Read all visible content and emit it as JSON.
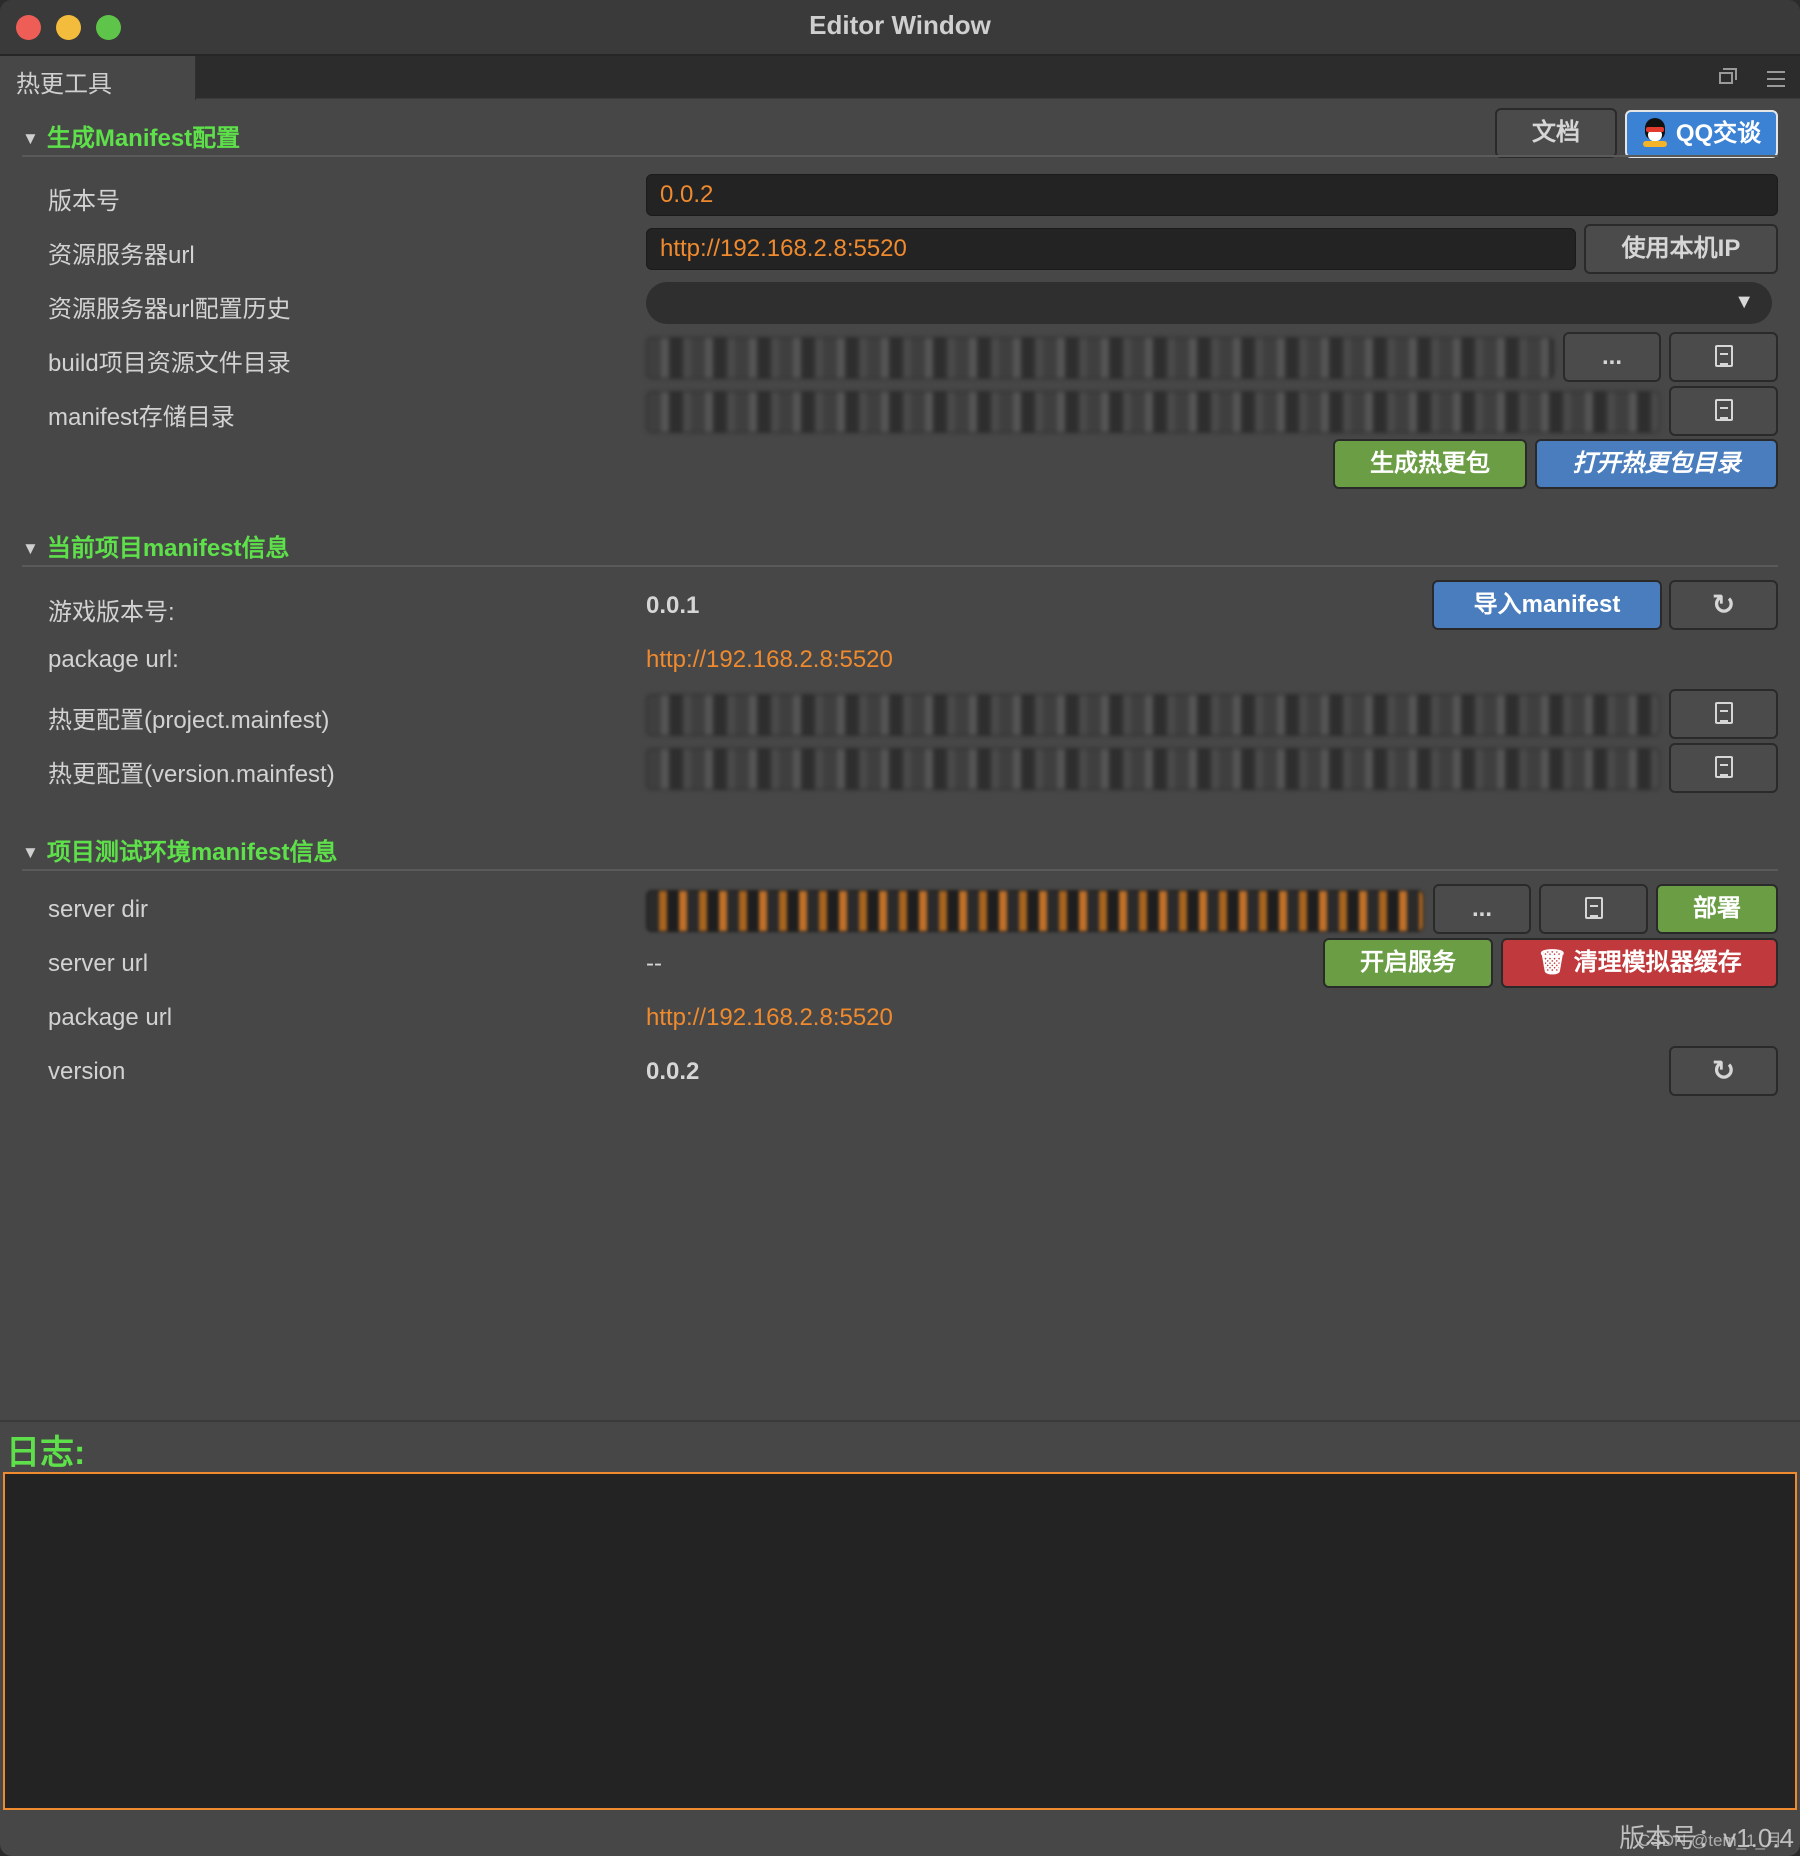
{
  "window": {
    "title": "Editor Window"
  },
  "tab": {
    "label": "热更工具"
  },
  "section_manifest": {
    "title": "生成Manifest配置",
    "doc_button": "文档",
    "qq_button": "QQ交谈",
    "version_label": "版本号",
    "version_value": "0.0.2",
    "server_url_label": "资源服务器url",
    "server_url_value": "http://192.168.2.8:5520",
    "use_local_ip_button": "使用本机IP",
    "url_history_label": "资源服务器url配置历史",
    "url_history_value": "",
    "build_dir_label": "build项目资源文件目录",
    "browse_button": "...",
    "manifest_dir_label": "manifest存储目录",
    "generate_button": "生成热更包",
    "open_dir_button": "打开热更包目录"
  },
  "section_current": {
    "title": "当前项目manifest信息",
    "game_version_label": "游戏版本号:",
    "game_version_value": "0.0.1",
    "import_button": "导入manifest",
    "package_url_label": "package url:",
    "package_url_value": "http://192.168.2.8:5520",
    "project_manifest_label": "热更配置(project.mainfest)",
    "version_manifest_label": "热更配置(version.mainfest)"
  },
  "section_test": {
    "title": "项目测试环境manifest信息",
    "server_dir_label": "server dir",
    "browse_button": "...",
    "deploy_button": "部署",
    "server_url_label": "server url",
    "server_url_value": "--",
    "start_service_button": "开启服务",
    "clear_cache_button": "清理模拟器缓存",
    "package_url_label": "package url",
    "package_url_value": "http://192.168.2.8:5520",
    "version_label": "version",
    "version_value": "0.0.2"
  },
  "log": {
    "title": "日志:"
  },
  "footer": {
    "version_text": "版本号：v1.0.4",
    "watermark": "CSDN @tem_1_月"
  },
  "colors": {
    "accent_green": "#5ee04a",
    "accent_orange": "#ef8a2e",
    "button_green": "#6a9d44",
    "button_blue": "#4a7dbd",
    "button_red": "#c0393c"
  },
  "icons": [
    "file-icon",
    "refresh-icon",
    "trash-icon",
    "qq-penguin-icon",
    "dropdown-caret-icon",
    "popout-icon",
    "menu-icon"
  ]
}
